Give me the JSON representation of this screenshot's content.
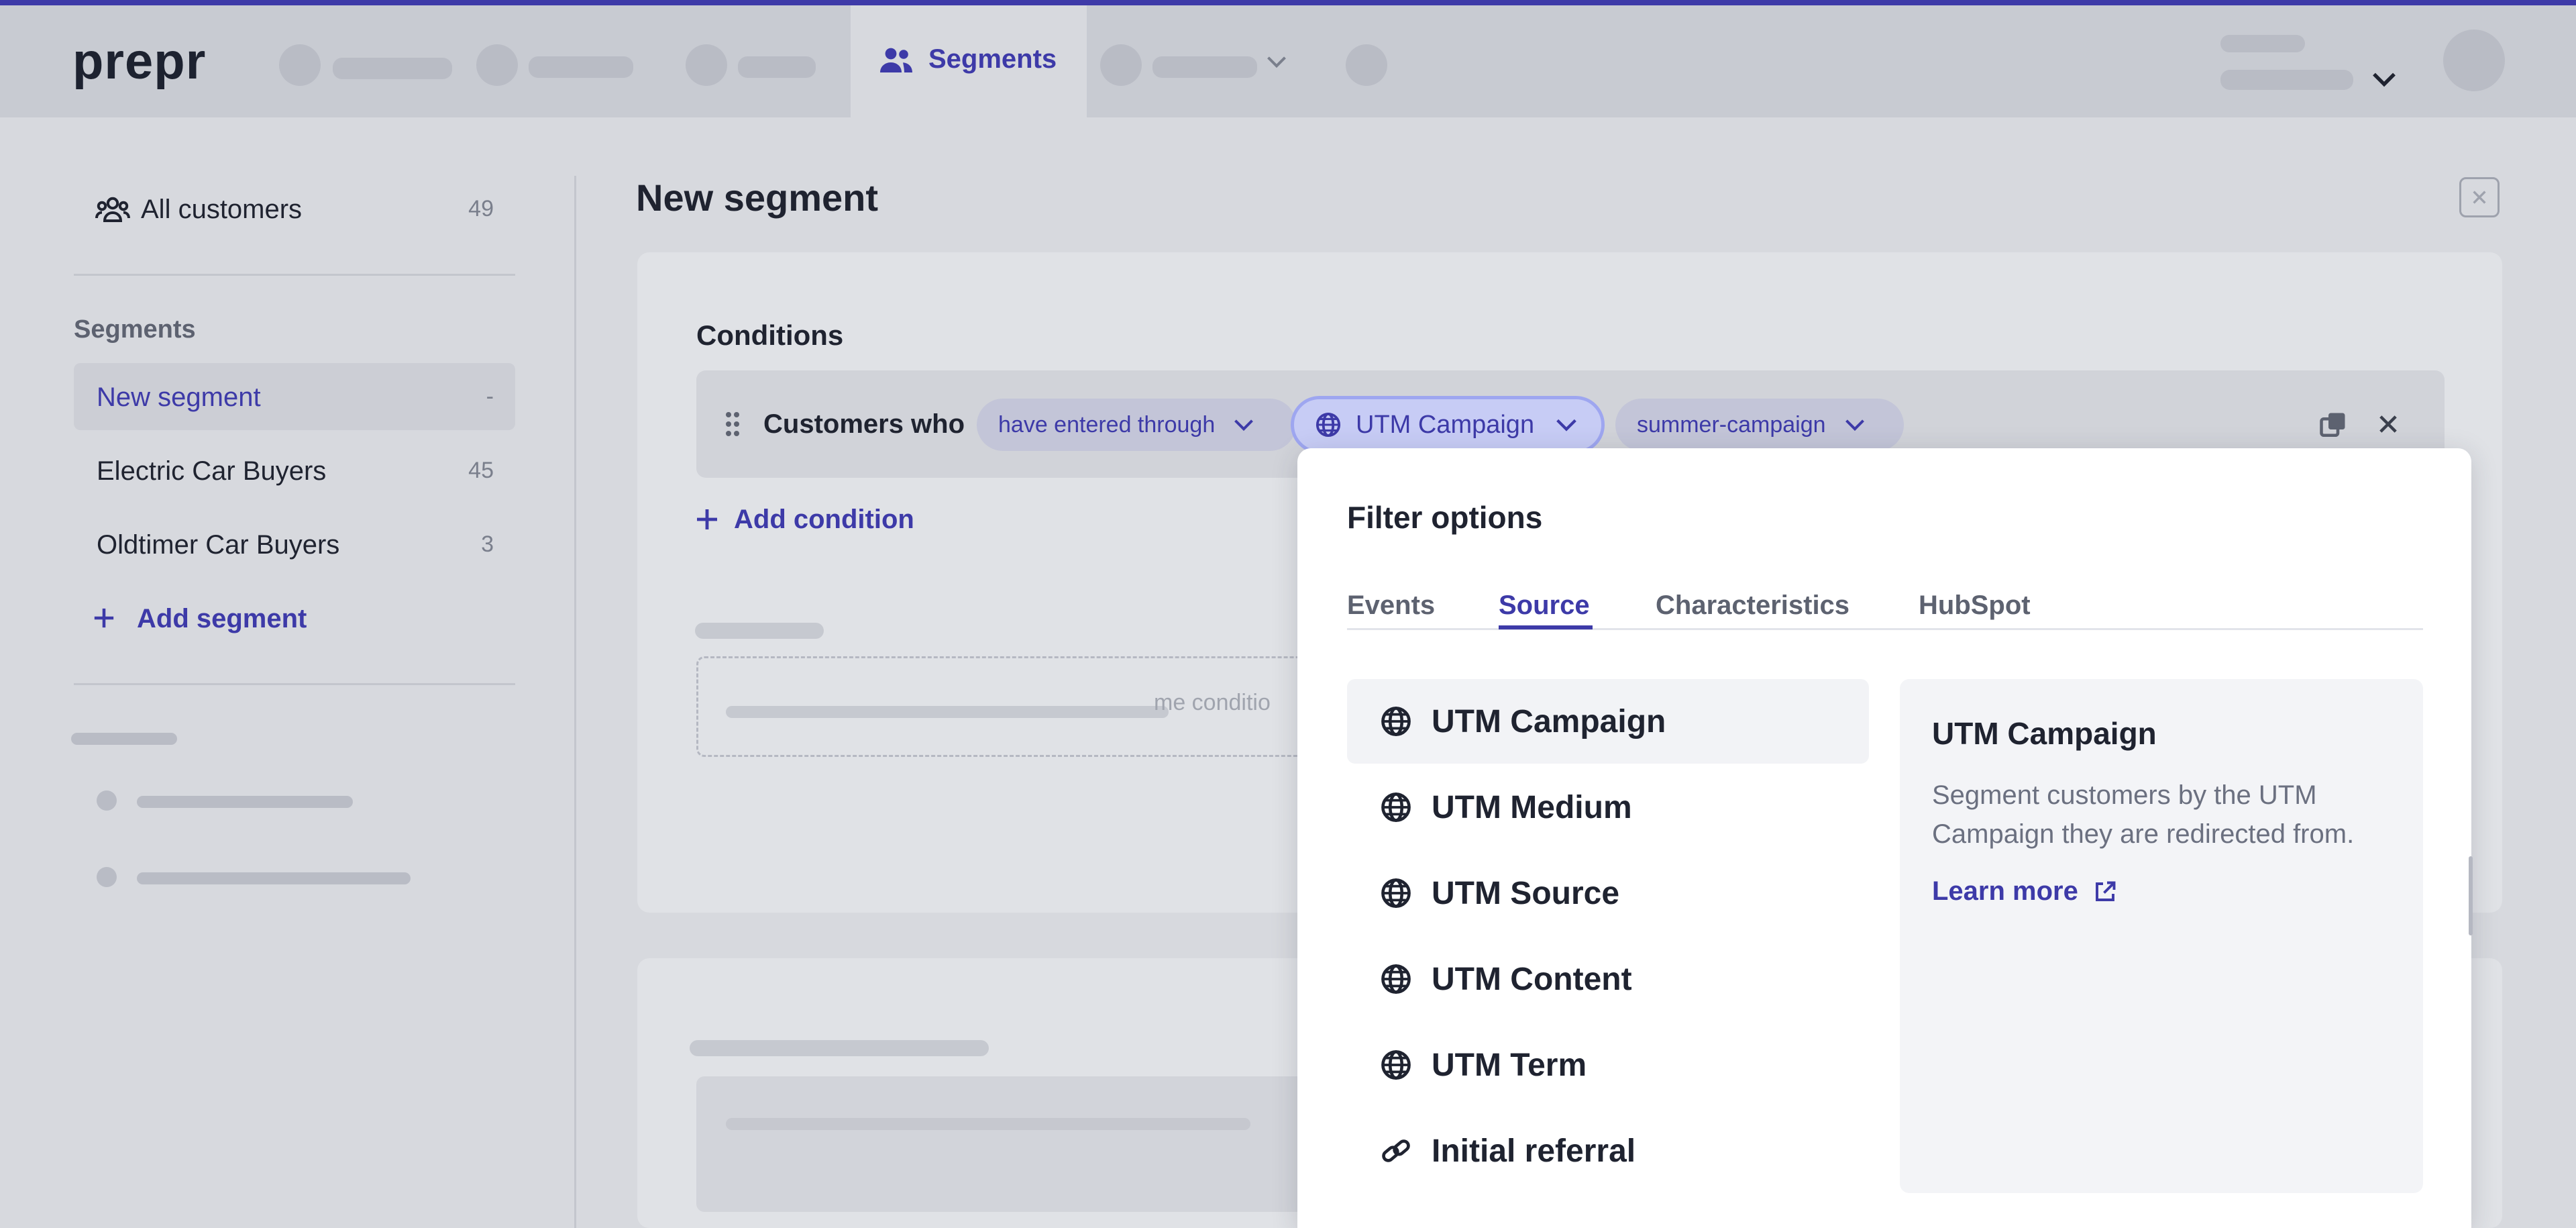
{
  "app": {
    "logo": "prepr"
  },
  "nav": {
    "active_tab": "Segments"
  },
  "sidebar": {
    "all_customers": {
      "label": "All customers",
      "count": "49"
    },
    "section_title": "Segments",
    "items": [
      {
        "label": "New segment",
        "count": "-"
      },
      {
        "label": "Electric Car Buyers",
        "count": "45"
      },
      {
        "label": "Oldtimer Car Buyers",
        "count": "3"
      }
    ],
    "add_label": "Add segment"
  },
  "main": {
    "title": "New segment",
    "conditions_title": "Conditions",
    "condition": {
      "prefix": "Customers who",
      "operator": "have entered through",
      "property": "UTM Campaign",
      "value": "summer-campaign"
    },
    "add_condition_label": "Add condition",
    "partial_text": "me conditio"
  },
  "popover": {
    "title": "Filter options",
    "tabs": [
      "Events",
      "Source",
      "Characteristics",
      "HubSpot"
    ],
    "active_tab": "Source",
    "options": [
      {
        "label": "UTM Campaign",
        "icon": "globe-icon"
      },
      {
        "label": "UTM Medium",
        "icon": "globe-icon"
      },
      {
        "label": "UTM Source",
        "icon": "globe-icon"
      },
      {
        "label": "UTM Content",
        "icon": "globe-icon"
      },
      {
        "label": "UTM Term",
        "icon": "globe-icon"
      },
      {
        "label": "Initial referral",
        "icon": "link-icon"
      }
    ],
    "detail": {
      "title": "UTM Campaign",
      "description": "Segment customers by the UTM Campaign they are redirected from.",
      "link": "Learn more"
    }
  },
  "colors": {
    "accent": "#3d3aa8",
    "top_border": "#3e3aa8",
    "overlay_bg": "#d7d9de"
  }
}
